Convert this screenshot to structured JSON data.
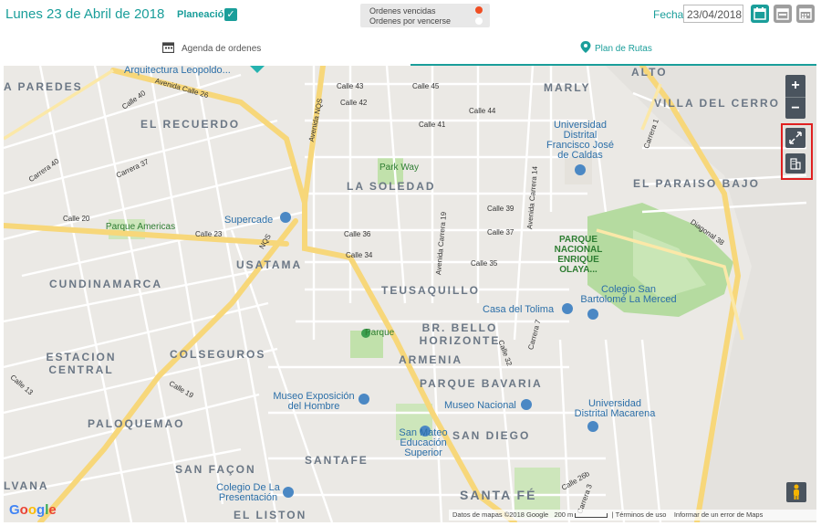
{
  "header": {
    "title": "Lunes 23 de Abril de 2018",
    "planeacion_label": "Planeación",
    "legend": {
      "overdue_label": "Ordenes vencidas",
      "upcoming_label": "Ordenes por vencerse",
      "overdue_color": "#f04e23",
      "upcoming_color": "#ffffff"
    },
    "fecha_label": "Fecha",
    "fecha_value": "23/04/2018"
  },
  "tabs": [
    {
      "label": "Agenda de ordenes",
      "icon": "calendar-icon"
    },
    {
      "label": "Plan de Rutas",
      "icon": "map-pin-icon",
      "active": true
    }
  ],
  "map": {
    "districts": [
      "A PAREDES",
      "EL RECUERDO",
      "MARLY",
      "VILLA DEL CERRO",
      "ALTO",
      "LA SOLEDAD",
      "EL PARAISO BAJO",
      "USATAMA",
      "CUNDINAMARCA",
      "TEUSAQUILLO",
      "BR. BELLO HORIZONTE",
      "ESTACION CENTRAL",
      "COLSEGUROS",
      "ARMENIA",
      "PARQUE BAVARIA",
      "PALOQUEMAO",
      "SAN DIEGO",
      "SAN FAÇON",
      "SANTAFE",
      "SANTA FÉ",
      "LVANA",
      "EL LISTON"
    ],
    "streets": [
      "Avenida Calle 26",
      "Avenida NQS",
      "Calle 45",
      "Calle 43",
      "Calle 42",
      "Calle 41",
      "Calle 44",
      "Carrera 1",
      "Calle 40",
      "Carrera 40",
      "Carrera 37",
      "Calle 20",
      "Calle 23",
      "Calle 34",
      "Calle 35",
      "Calle 36",
      "Calle 37",
      "Calle 39",
      "NQS",
      "Avenida Carrera 14",
      "Avenida Carrera 19",
      "Diagonal 38",
      "Carrera 7",
      "Calle 19",
      "Calle 13",
      "Calle 32",
      "Calle 26b",
      "Carrera 3"
    ],
    "places": [
      "Arquitectura Leopoldo...",
      "Universidad Distrital Francisco José de Caldas",
      "Supercade",
      "Casa del Tolima",
      "Colegio San Bartolomé La Merced",
      "Museo Exposición del Hombre",
      "Museo Nacional",
      "Universidad Distrital Macarena",
      "San Mateo Educación Superior",
      "Colegio De La Presentación"
    ],
    "parks": [
      "Park Way",
      "Parque Americas",
      "PARQUE NACIONAL ENRIQUE OLAYA...",
      "Parque"
    ],
    "zoom_in": "+",
    "zoom_out": "−",
    "logo": "Google",
    "footer": {
      "data": "Datos de mapas ©2018 Google",
      "scale": "200 m",
      "terms": "Términos de uso",
      "report": "Informar de un error de Maps"
    }
  }
}
